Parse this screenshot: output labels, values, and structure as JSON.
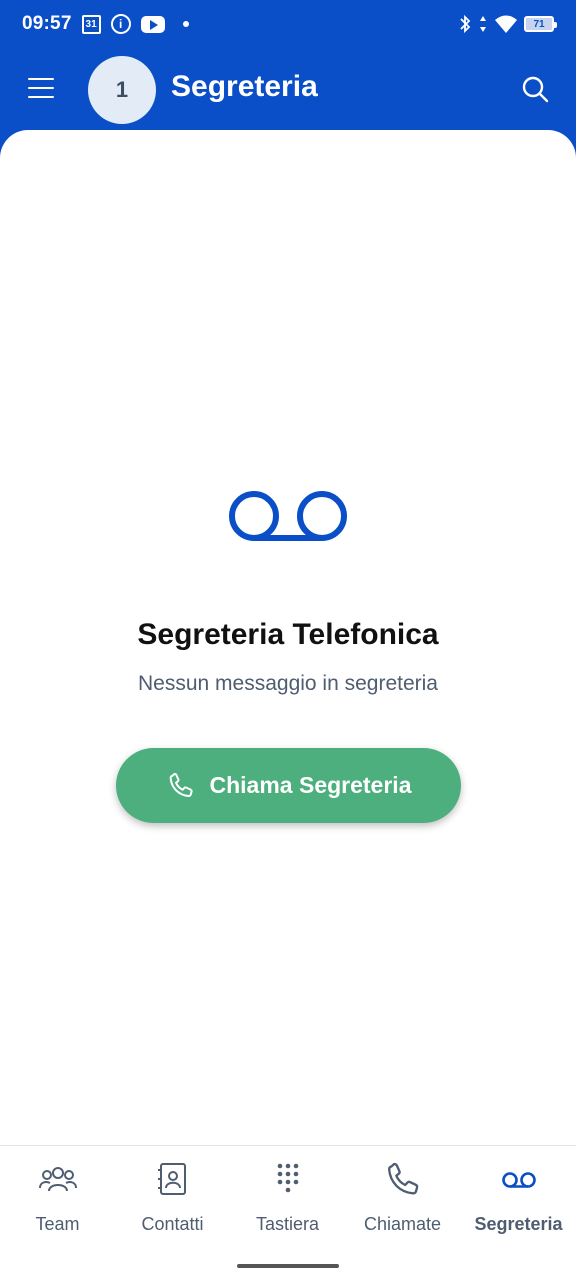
{
  "status_bar": {
    "time": "09:57",
    "calendar_day": "31",
    "battery": "71"
  },
  "app_bar": {
    "avatar_text": "1",
    "title": "Segreteria"
  },
  "empty_state": {
    "title": "Segreteria Telefonica",
    "subtitle": "Nessun messaggio in segreteria",
    "button_label": "Chiama Segreteria"
  },
  "bottom_nav": {
    "items": [
      {
        "label": "Team",
        "icon": "team-icon",
        "active": false
      },
      {
        "label": "Contatti",
        "icon": "contacts-icon",
        "active": false
      },
      {
        "label": "Tastiera",
        "icon": "keypad-icon",
        "active": false
      },
      {
        "label": "Chiamate",
        "icon": "phone-icon",
        "active": false
      },
      {
        "label": "Segreteria",
        "icon": "voicemail-icon",
        "active": true
      }
    ]
  },
  "colors": {
    "primary": "#0a4fc7",
    "call_button": "#4caf7d",
    "muted_text": "#4f5d70"
  }
}
